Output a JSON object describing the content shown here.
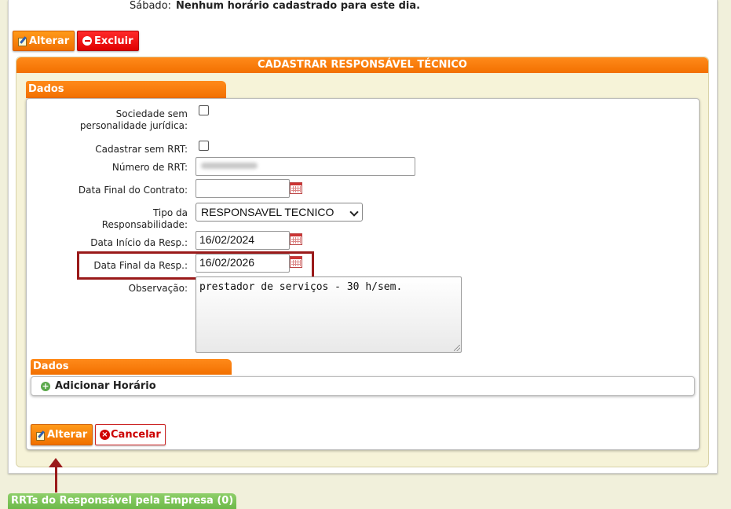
{
  "top": {
    "sabado_label": "Sábado:",
    "sabado_value": "Nenhum horário cadastrado para este dia."
  },
  "actions": {
    "alterar": "Alterar",
    "excluir": "Excluir"
  },
  "panel": {
    "title": "CADASTRAR RESPONSÁVEL TÉCNICO",
    "tab_dados": "Dados"
  },
  "form": {
    "sociedade_label": "Sociedade sem personalidade jurídica:",
    "sociedade_checked": false,
    "sem_rrt_label": "Cadastrar sem RRT:",
    "sem_rrt_checked": false,
    "numero_rrt_label": "Número de RRT:",
    "numero_rrt_value": "",
    "data_final_contrato_label": "Data Final do Contrato:",
    "data_final_contrato_value": "",
    "tipo_resp_label": "Tipo da Responsabilidade:",
    "tipo_resp_value": "RESPONSAVEL TECNICO",
    "data_inicio_label": "Data Início da Resp.:",
    "data_inicio_value": "16/02/2024",
    "data_final_label": "Data Final da Resp.:",
    "data_final_value": "16/02/2026",
    "observacao_label": "Observação:",
    "observacao_value": "prestador de serviços - 30 h/sem."
  },
  "horario": {
    "tab": "Dados",
    "add_label": "Adicionar Horário"
  },
  "footer": {
    "alterar": "Alterar",
    "cancelar": "Cancelar"
  },
  "bottom_tab": "RRTs do Responsável pela Empresa (0)",
  "colors": {
    "orange": "#f27000",
    "red": "#e00000",
    "highlight": "#9a1a1a",
    "green": "#6db94a",
    "panel_bg": "#f6f3d8"
  }
}
